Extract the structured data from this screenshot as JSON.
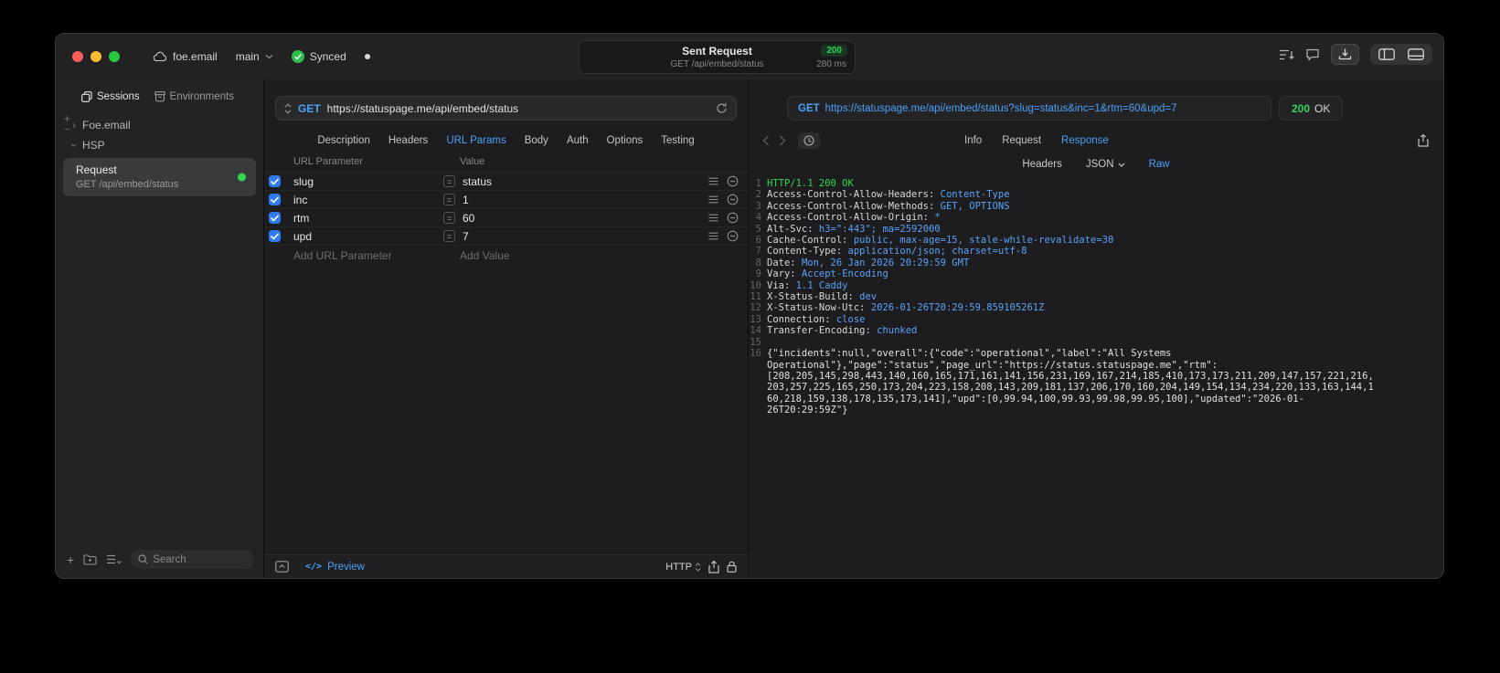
{
  "colors": {
    "accent_blue": "#4BA1F7",
    "success_green": "#30D158",
    "status_green": "#32D74B"
  },
  "titlebar": {
    "project": "foe.email",
    "branch": "main",
    "sync_label": "Synced",
    "capsule": {
      "title": "Sent Request",
      "status_code": "200",
      "method_path": "GET /api/embed/status",
      "duration": "280 ms"
    }
  },
  "sidebar": {
    "tabs": [
      {
        "label": "Sessions"
      },
      {
        "label": "Environments"
      }
    ],
    "tree": [
      {
        "label": "Foe.email",
        "expanded": false
      },
      {
        "label": "HSP",
        "expanded": true
      }
    ],
    "request_item": {
      "title": "Request",
      "subtitle": "GET /api/embed/status"
    },
    "search_placeholder": "Search"
  },
  "request_panel": {
    "method": "GET",
    "url": "https://statuspage.me/api/embed/status",
    "tabs": [
      "Description",
      "Headers",
      "URL Params",
      "Body",
      "Auth",
      "Options",
      "Testing"
    ],
    "active_tab": "URL Params",
    "table": {
      "columns": [
        "URL Parameter",
        "Value"
      ],
      "rows": [
        {
          "enabled": true,
          "name": "slug",
          "value": "status"
        },
        {
          "enabled": true,
          "name": "inc",
          "value": "1"
        },
        {
          "enabled": true,
          "name": "rtm",
          "value": "60"
        },
        {
          "enabled": true,
          "name": "upd",
          "value": "7"
        }
      ],
      "add_name_placeholder": "Add URL Parameter",
      "add_value_placeholder": "Add Value"
    },
    "footer": {
      "preview_icon": "</>",
      "preview_label": "Preview",
      "protocol": "HTTP"
    }
  },
  "response_panel": {
    "request_line": {
      "method": "GET",
      "url": "https://statuspage.me/api/embed/status?slug=status&inc=1&rtm=60&upd=7"
    },
    "status_code": "200",
    "status_text": "OK",
    "tabs": [
      "Info",
      "Request",
      "Response"
    ],
    "active_tab": "Response",
    "subtabs": [
      {
        "label": "Headers"
      },
      {
        "label": "JSON",
        "dropdown": true
      },
      {
        "label": "Raw"
      }
    ],
    "active_subtab": "Raw",
    "code": {
      "lines": [
        {
          "n": "1",
          "type": "status",
          "text": "HTTP/1.1 200 OK"
        },
        {
          "n": "2",
          "type": "header",
          "name": "Access-Control-Allow-Headers: ",
          "value": "Content-Type"
        },
        {
          "n": "3",
          "type": "header",
          "name": "Access-Control-Allow-Methods: ",
          "value": "GET, OPTIONS"
        },
        {
          "n": "4",
          "type": "header",
          "name": "Access-Control-Allow-Origin: ",
          "value": "*"
        },
        {
          "n": "5",
          "type": "header",
          "name": "Alt-Svc: ",
          "value": "h3=\":443\"; ma=2592000"
        },
        {
          "n": "6",
          "type": "header",
          "name": "Cache-Control: ",
          "value": "public, max-age=15, stale-while-revalidate=30"
        },
        {
          "n": "7",
          "type": "header",
          "name": "Content-Type: ",
          "value": "application/json; charset=utf-8"
        },
        {
          "n": "8",
          "type": "header",
          "name": "Date: ",
          "value": "Mon, 26 Jan 2026 20:29:59 GMT"
        },
        {
          "n": "9",
          "type": "header",
          "name": "Vary: ",
          "value": "Accept-Encoding"
        },
        {
          "n": "10",
          "type": "header",
          "name": "Via: ",
          "value": "1.1 Caddy"
        },
        {
          "n": "11",
          "type": "header",
          "name": "X-Status-Build: ",
          "value": "dev"
        },
        {
          "n": "12",
          "type": "header",
          "name": "X-Status-Now-Utc: ",
          "value": "2026-01-26T20:29:59.859105261Z"
        },
        {
          "n": "13",
          "type": "header",
          "name": "Connection: ",
          "value": "close"
        },
        {
          "n": "14",
          "type": "header",
          "name": "Transfer-Encoding: ",
          "value": "chunked"
        },
        {
          "n": "15",
          "type": "blank",
          "text": ""
        },
        {
          "n": "16",
          "type": "body",
          "text": "{\"incidents\":null,\"overall\":{\"code\":\"operational\",\"label\":\"All Systems Operational\"},\"page\":\"status\",\"page_url\":\"https://status.statuspage.me\",\"rtm\":[208,205,145,298,443,140,160,165,171,161,141,156,231,169,167,214,185,410,173,173,211,209,147,157,221,216,203,257,225,165,250,173,204,223,158,208,143,209,181,137,206,170,160,204,149,154,134,234,220,133,163,144,160,218,159,138,178,135,173,141],\"upd\":[0,99.94,100,99.93,99.98,99.95,100],\"updated\":\"2026-01-26T20:29:59Z\"}"
        }
      ]
    }
  }
}
